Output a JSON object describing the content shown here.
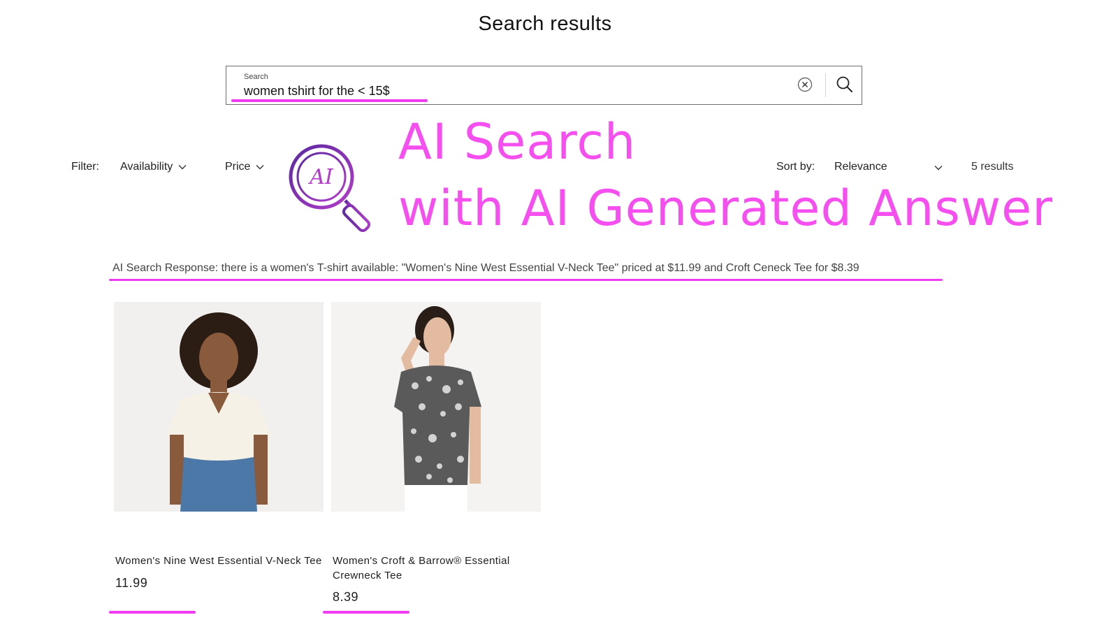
{
  "page": {
    "title": "Search results"
  },
  "search": {
    "label": "Search",
    "value": "women tshirt for the < 15$",
    "clear_icon": "close-circle-icon",
    "submit_icon": "search-icon"
  },
  "filters": {
    "label": "Filter:",
    "availability": "Availability",
    "price": "Price"
  },
  "sort": {
    "label": "Sort by:",
    "selected": "Relevance"
  },
  "results": {
    "count": "5 results"
  },
  "banner": {
    "line1": "AI Search",
    "line2": "with AI Generated Answer",
    "icon_text": "AI",
    "color": "#f54ff0"
  },
  "ai_response": {
    "text": "AI Search Response: there is a women's T-shirt available: \"Women's Nine West Essential V-Neck Tee\" priced at $11.99 and Croft Ceneck Tee for $8.39"
  },
  "products": [
    {
      "name": "Women's Nine West Essential V-Neck Tee",
      "price": "11.99"
    },
    {
      "name": "Women's Croft & Barrow® Essential Crewneck Tee",
      "price": "8.39"
    }
  ],
  "colors": {
    "highlight": "#f03cf0",
    "icon_purple": "#7b2fa8"
  }
}
